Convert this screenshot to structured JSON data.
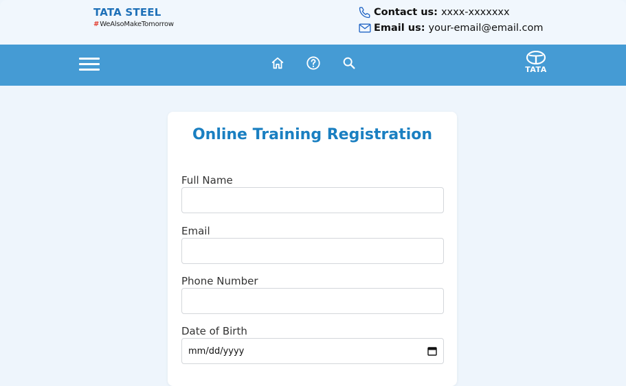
{
  "header": {
    "brand_name": "TATA STEEL",
    "brand_hash": "#",
    "brand_tagline": "WeAlsoMakeTomorrow",
    "contact_label": "Contact us:",
    "contact_value": "xxxx-xxxxxxx",
    "email_label": "Email us:",
    "email_value": "your-email@email.com"
  },
  "nav": {
    "logo_text": "TATA",
    "icons": [
      "menu-icon",
      "home-icon",
      "help-icon",
      "search-icon",
      "tata-logo-icon"
    ]
  },
  "form": {
    "title": "Online Training Registration",
    "fields": [
      {
        "label": "Full Name",
        "value": ""
      },
      {
        "label": "Email",
        "value": ""
      },
      {
        "label": "Phone Number",
        "value": ""
      },
      {
        "label": "Date of Birth",
        "value": "mm/dd/yyyy"
      }
    ]
  },
  "colors": {
    "brand_blue": "#1e70b8",
    "nav_blue": "#459bd4",
    "title_blue": "#1a7fc1",
    "page_bg": "#eef5fc"
  }
}
